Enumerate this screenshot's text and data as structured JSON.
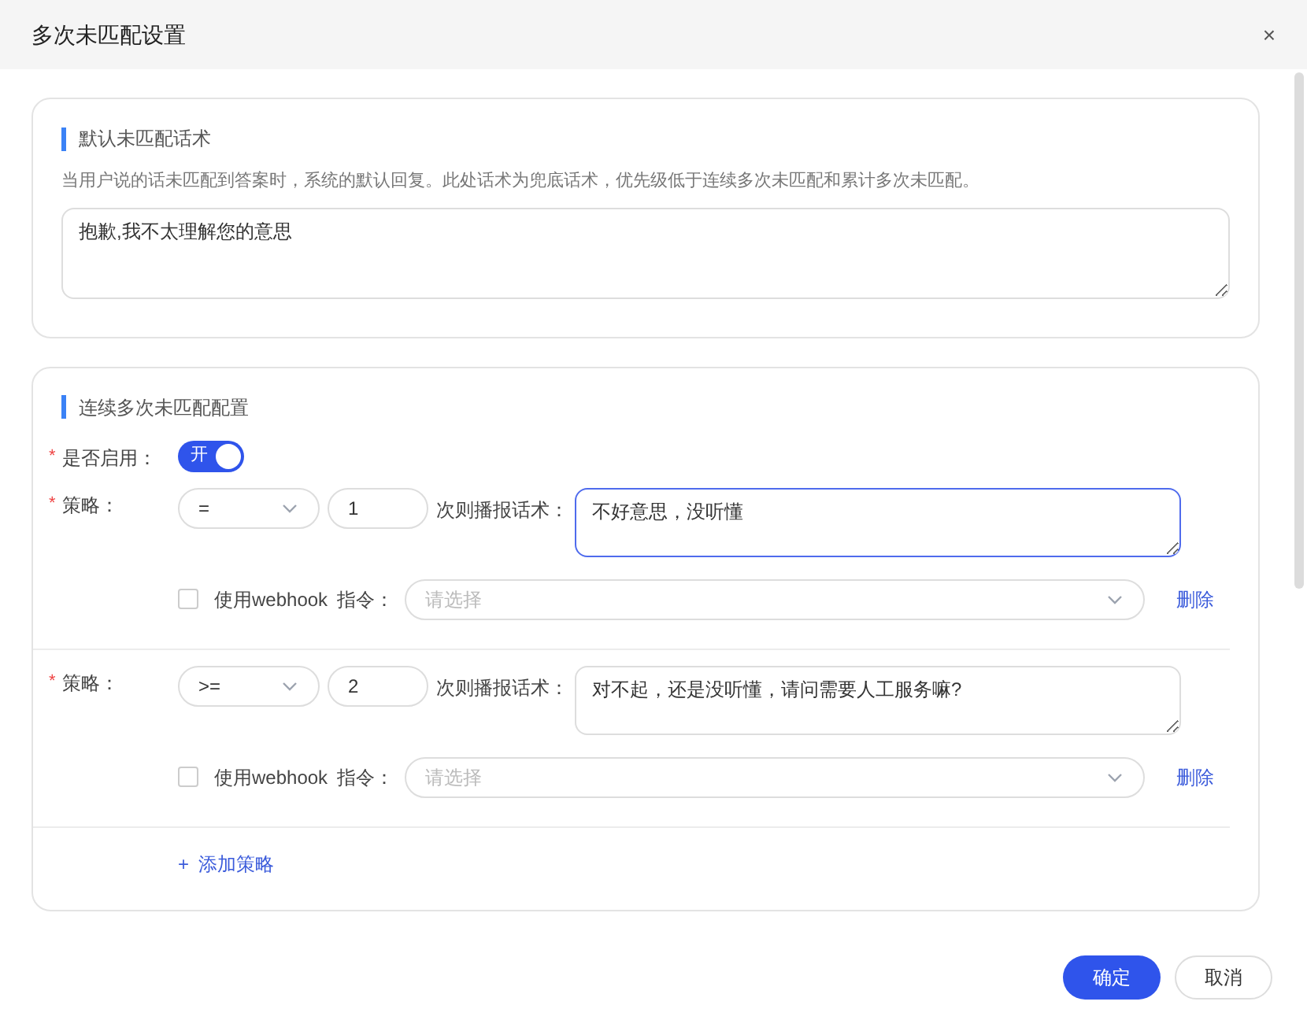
{
  "dialog": {
    "title": "多次未匹配设置",
    "close": "×"
  },
  "default_section": {
    "title": "默认未匹配话术",
    "description": "当用户说的话未匹配到答案时，系统的默认回复。此处话术为兜底话术，优先级低于连续多次未匹配和累计多次未匹配。",
    "reply": "抱歉,我不太理解您的意思"
  },
  "consecutive_section": {
    "title": "连续多次未匹配配置",
    "enable": {
      "required_mark": "*",
      "label": "是否启用：",
      "on": true,
      "toggle_text": "开"
    },
    "strategies": [
      {
        "required_mark": "*",
        "label": "策略：",
        "operator": "=",
        "count": "1",
        "reply_label": "次则播报话术：",
        "reply": "不好意思，没听懂",
        "focused": true,
        "webhook_checked": false,
        "webhook_label": "使用webhook",
        "command_label": "指令：",
        "command_placeholder": "请选择",
        "delete": "删除"
      },
      {
        "required_mark": "*",
        "label": "策略：",
        "operator": ">=",
        "count": "2",
        "reply_label": "次则播报话术：",
        "reply": "对不起，还是没听懂，请问需要人工服务嘛?",
        "focused": false,
        "webhook_checked": false,
        "webhook_label": "使用webhook",
        "command_label": "指令：",
        "command_placeholder": "请选择",
        "delete": "删除"
      }
    ],
    "add_strategy": {
      "icon": "+",
      "label": "添加策略"
    }
  },
  "buttons": [
    {
      "label": "确定",
      "kind": "primary"
    },
    {
      "label": "取消",
      "kind": "secondary"
    }
  ]
}
